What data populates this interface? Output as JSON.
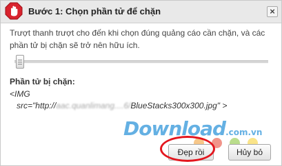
{
  "dialog": {
    "title": "Bước 1: Chọn phần tử để chặn",
    "close_label": "×",
    "instruction": "Trượt thanh trượt cho đến khi chọn đúng quảng cáo cần chặn, và các phần tử bị chặn sẽ trở nên hữu ích.",
    "slider": {
      "value": 0
    },
    "blocked_label": "Phần tử bị chặn:",
    "code_line1": "<IMG",
    "code_src_prefix": "src=\"http://",
    "code_src_blurred": "aac.quanlimang....6/",
    "code_src_suffix": "BlueStacks300x300.jpg\" >",
    "ok_label": "Đẹp rồi",
    "cancel_label": "Hủy bỏ"
  },
  "watermark": {
    "brand": "Download",
    "tld": ".com.vn"
  },
  "colors": {
    "highlight": "#e3161e",
    "stop_icon": "#d9232e",
    "watermark": "#4aa3df"
  }
}
